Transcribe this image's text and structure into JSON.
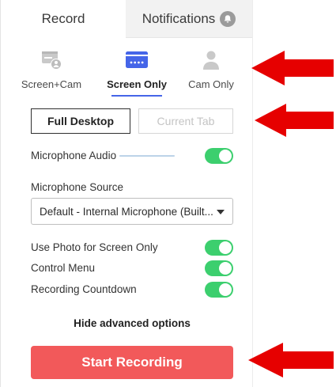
{
  "tabs": {
    "record_label": "Record",
    "notifications_label": "Notifications"
  },
  "modes": [
    {
      "label": "Screen+Cam",
      "icon": "screen-cam-icon",
      "active": false
    },
    {
      "label": "Screen Only",
      "icon": "screen-only-icon",
      "active": true
    },
    {
      "label": "Cam Only",
      "icon": "cam-only-icon",
      "active": false
    }
  ],
  "capture": {
    "full_desktop_label": "Full Desktop",
    "current_tab_label": "Current Tab"
  },
  "microphone_audio": {
    "label": "Microphone Audio",
    "enabled": true
  },
  "microphone_source": {
    "label": "Microphone Source",
    "selected": "Default - Internal Microphone (Built..."
  },
  "options": [
    {
      "label": "Use Photo for Screen Only",
      "enabled": true
    },
    {
      "label": "Control Menu",
      "enabled": true
    },
    {
      "label": "Recording Countdown",
      "enabled": true
    }
  ],
  "hide_advanced_label": "Hide advanced options",
  "start_label": "Start Recording",
  "colors": {
    "accent": "#4565e8",
    "toggle_on": "#3ccf6e",
    "start_button": "#f2595a",
    "annotation_arrow": "#e60000"
  }
}
